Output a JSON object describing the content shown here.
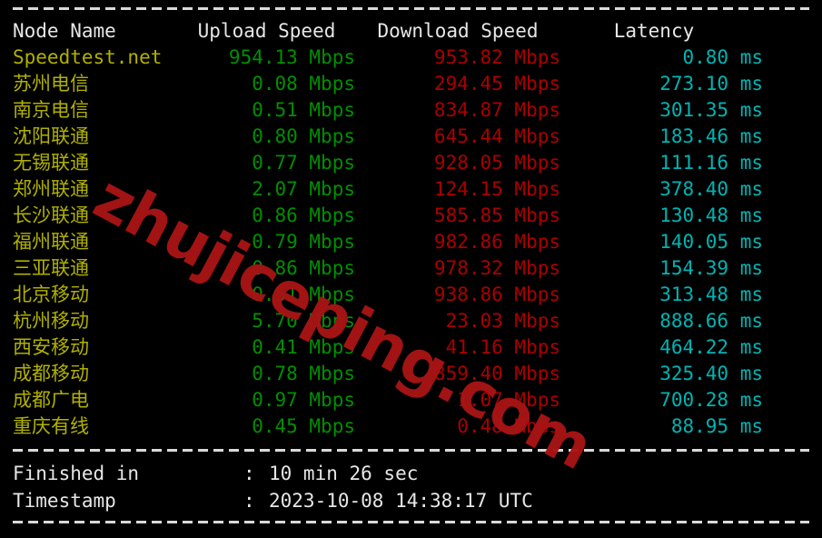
{
  "terminal": {
    "separator_top": "------------------------------------------------------------------------------",
    "separator_mid": "------------------------------------------------------------------------------",
    "separator_bottom": "------------------------------------------------------------------------------"
  },
  "watermark": {
    "text": "zhujiceping.com",
    "color": "#a81414"
  },
  "colors": {
    "background": "#000000",
    "header_text": "#e6e6e6",
    "node_name": "#b0b000",
    "upload": "#008f00",
    "download": "#aa0000",
    "latency": "#00b4b4",
    "separator": "#d9d9d9"
  },
  "table": {
    "headers": {
      "node": "Node Name",
      "upload": "Upload Speed",
      "download": "Download Speed",
      "latency": "Latency"
    },
    "rows": [
      {
        "node": "Speedtest.net",
        "upload": "954.13 Mbps",
        "download": "953.82 Mbps",
        "latency": "0.80 ms"
      },
      {
        "node": "苏州电信",
        "upload": "0.08 Mbps",
        "download": "294.45 Mbps",
        "latency": "273.10 ms"
      },
      {
        "node": "南京电信",
        "upload": "0.51 Mbps",
        "download": "834.87 Mbps",
        "latency": "301.35 ms"
      },
      {
        "node": "沈阳联通",
        "upload": "0.80 Mbps",
        "download": "645.44 Mbps",
        "latency": "183.46 ms"
      },
      {
        "node": "无锡联通",
        "upload": "0.77 Mbps",
        "download": "928.05 Mbps",
        "latency": "111.16 ms"
      },
      {
        "node": "郑州联通",
        "upload": "2.07 Mbps",
        "download": "124.15 Mbps",
        "latency": "378.40 ms"
      },
      {
        "node": "长沙联通",
        "upload": "0.86 Mbps",
        "download": "585.85 Mbps",
        "latency": "130.48 ms"
      },
      {
        "node": "福州联通",
        "upload": "0.79 Mbps",
        "download": "982.86 Mbps",
        "latency": "140.05 ms"
      },
      {
        "node": "三亚联通",
        "upload": "0.86 Mbps",
        "download": "978.32 Mbps",
        "latency": "154.39 ms"
      },
      {
        "node": "北京移动",
        "upload": "0.51 Mbps",
        "download": "938.86 Mbps",
        "latency": "313.48 ms"
      },
      {
        "node": "杭州移动",
        "upload": "5.70 Mbps",
        "download": "23.03 Mbps",
        "latency": "888.66 ms"
      },
      {
        "node": "西安移动",
        "upload": "0.41 Mbps",
        "download": "41.16 Mbps",
        "latency": "464.22 ms"
      },
      {
        "node": "成都移动",
        "upload": "0.78 Mbps",
        "download": "859.40 Mbps",
        "latency": "325.40 ms"
      },
      {
        "node": "成都广电",
        "upload": "0.97 Mbps",
        "download": "1.07 Mbps",
        "latency": "700.28 ms"
      },
      {
        "node": "重庆有线",
        "upload": "0.45 Mbps",
        "download": "0.48 Mbps",
        "latency": "88.95 ms"
      }
    ]
  },
  "summary": {
    "finished_label": "Finished in",
    "finished_colon": ":",
    "finished_value": "10 min 26 sec",
    "timestamp_label": "Timestamp",
    "timestamp_colon": ":",
    "timestamp_value": "2023-10-08 14:38:17 UTC"
  }
}
